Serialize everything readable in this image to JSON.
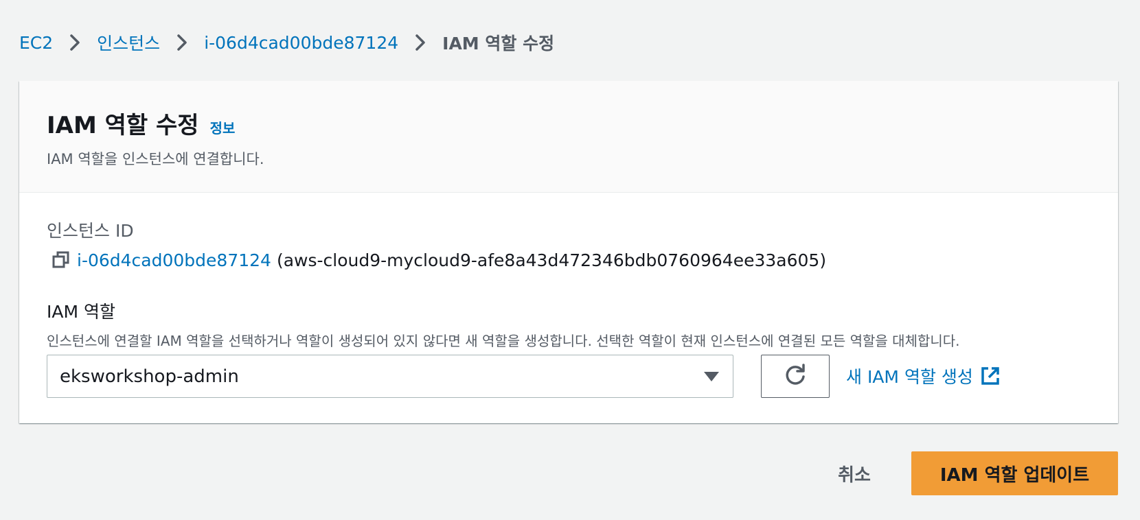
{
  "colors": {
    "link": "#0073bb",
    "primary_button": "#f19c36",
    "background": "#f2f3f3",
    "text": "#16191f",
    "secondary_text": "#545b64"
  },
  "breadcrumb": {
    "items": [
      {
        "label": "EC2"
      },
      {
        "label": "인스턴스"
      },
      {
        "label": "i-06d4cad00bde87124"
      }
    ],
    "current": "IAM 역할 수정",
    "separator_icon": "chevron-right-icon"
  },
  "panel": {
    "title": "IAM 역할 수정",
    "info_label": "정보",
    "description": "IAM 역할을 인스턴스에 연결합니다."
  },
  "instance": {
    "label": "인스턴스 ID",
    "id": "i-06d4cad00bde87124",
    "name": "(aws-cloud9-mycloud9-afe8a43d472346bdb0760964ee33a605)",
    "copy_icon": "copy-icon"
  },
  "iam_role": {
    "label": "IAM 역할",
    "description": "인스턴스에 연결할 IAM 역할을 선택하거나 역할이 생성되어 있지 않다면 새 역할을 생성합니다. 선택한 역할이 현재 인스턴스에 연결된 모든 역할을 대체합니다.",
    "selected": "eksworkshop-admin",
    "refresh_icon": "refresh-icon",
    "create_link": "새 IAM 역할 생성",
    "external_icon": "external-link-icon"
  },
  "actions": {
    "cancel_label": "취소",
    "submit_label": "IAM 역할 업데이트"
  }
}
